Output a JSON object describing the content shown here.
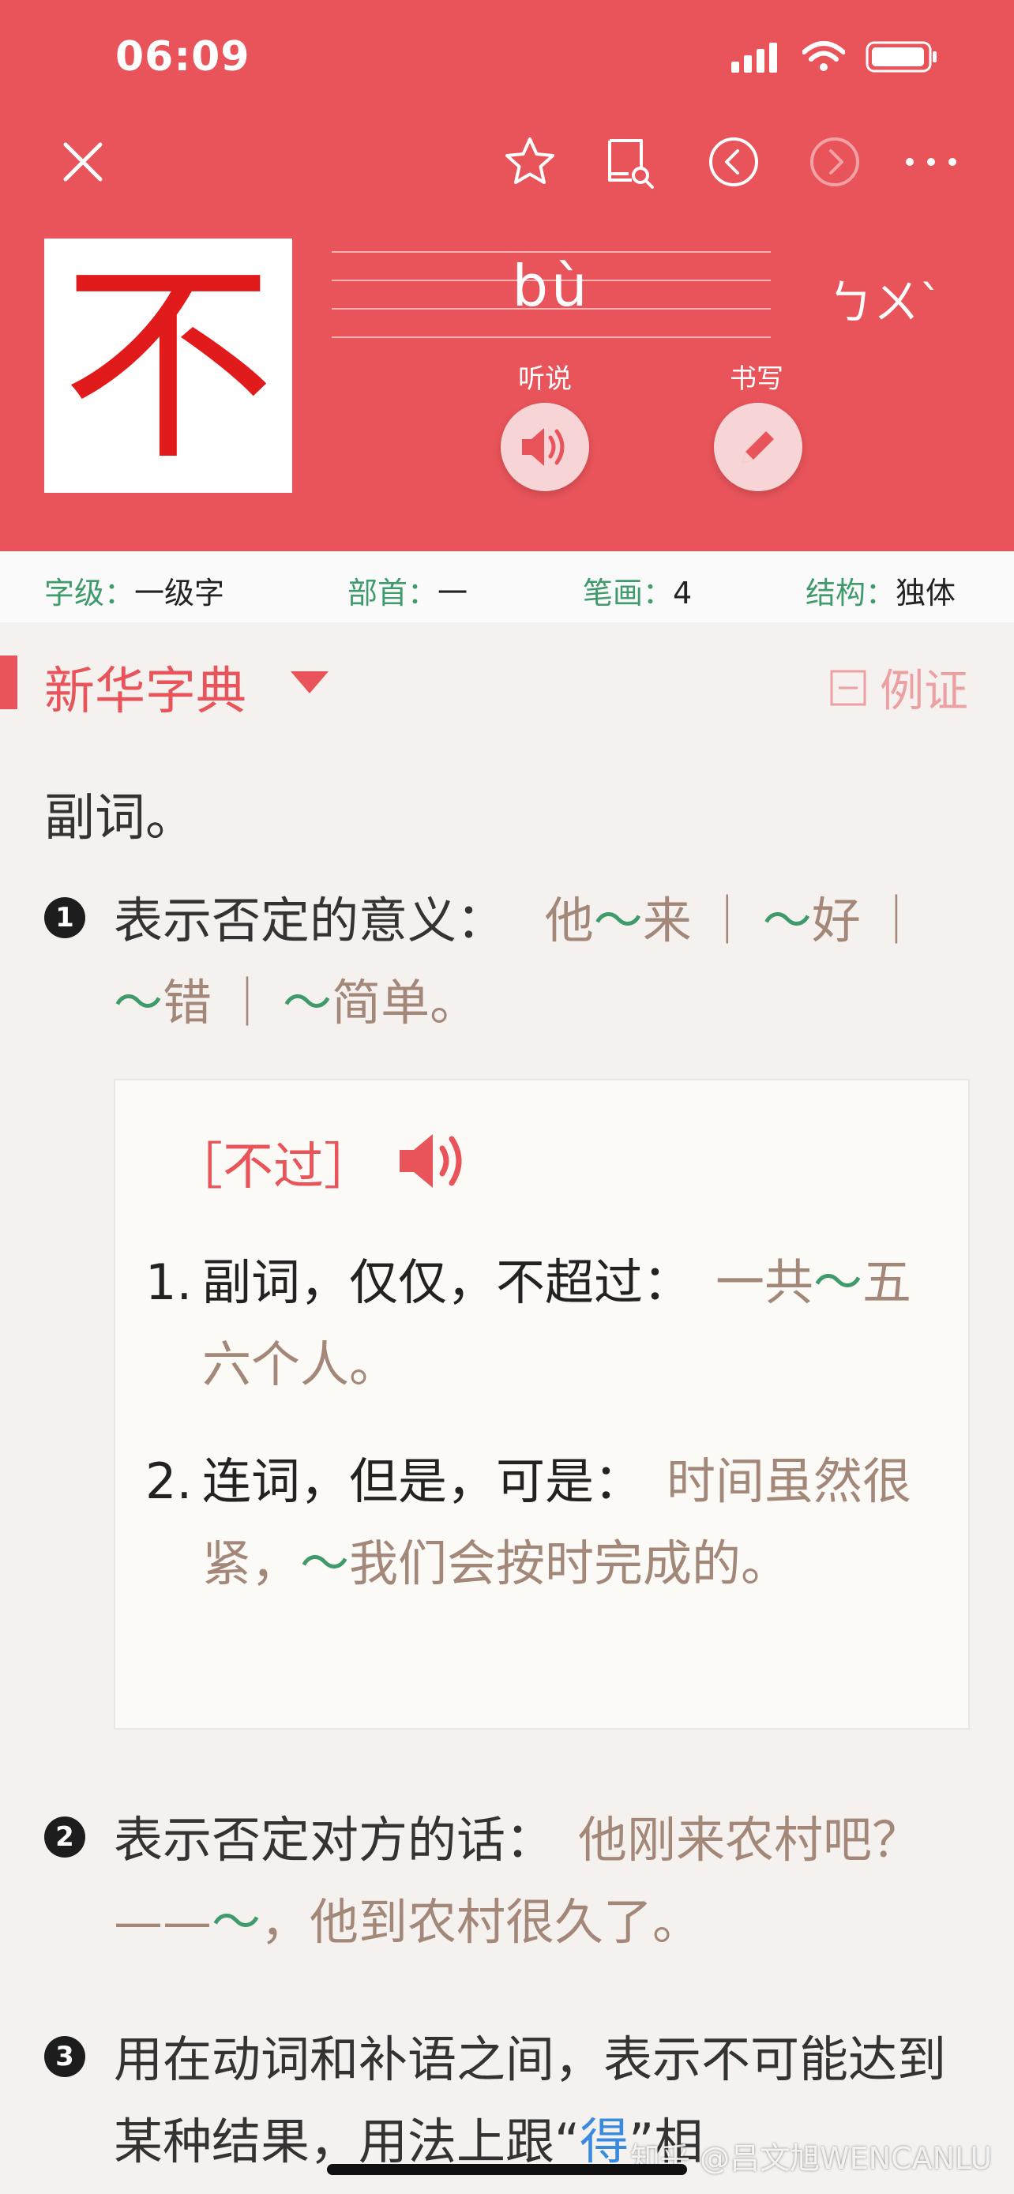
{
  "status": {
    "time": "06:09"
  },
  "entry": {
    "character": "不",
    "pinyin": "bù",
    "zhuyin": "ㄅㄨˋ",
    "listen_label": "听说",
    "write_label": "书写"
  },
  "info": {
    "level_label": "字级：",
    "level_value": "一级字",
    "radical_label": "部首：",
    "radical_value": "一",
    "strokes_label": "笔画：",
    "strokes_value": "4",
    "structure_label": "结构：",
    "structure_value": "独体"
  },
  "dict": {
    "title": "新华字典",
    "example_toggle": "例证",
    "pos": "副词。"
  },
  "defs": [
    {
      "num": "1",
      "text": "表示否定的意义：",
      "ex1a": "他",
      "ex1t": "～",
      "ex1b": "来",
      "sep1": "｜",
      "ex2t": "～",
      "ex2b": "好",
      "sep2": "｜",
      "ex3t": "～",
      "ex3b": "错",
      "sep3": "｜",
      "ex4t": "～",
      "ex4b": "简单。"
    },
    {
      "num": "2",
      "text": "表示否定对方的话：",
      "ex_a": "他刚来农村吧？——",
      "ex_t": "～",
      "ex_b": "，他到农村很久了。"
    },
    {
      "num": "3",
      "text_a": "用在动词和补语之间，表示不可能达到某种结果，用法上跟“",
      "text_blue": "得",
      "text_b": "”相"
    }
  ],
  "card": {
    "title": "［不过］",
    "items": [
      {
        "idx": "1.",
        "text": "副词，仅仅，不超过：",
        "ex_a": "一共",
        "ex_t": "～",
        "ex_b": "五六个人。"
      },
      {
        "idx": "2.",
        "text": "连词，但是，可是：",
        "ex_a": "时间虽然很紧，",
        "ex_t": "～",
        "ex_b": "我们会按时完成的。"
      }
    ]
  },
  "watermark": "知乎 @吕文旭WENCANLU",
  "colors": {
    "header": "#e8545a",
    "accent_green": "#3f9a6c",
    "example_brown": "#a3887a",
    "char_red": "#e11b1b"
  }
}
